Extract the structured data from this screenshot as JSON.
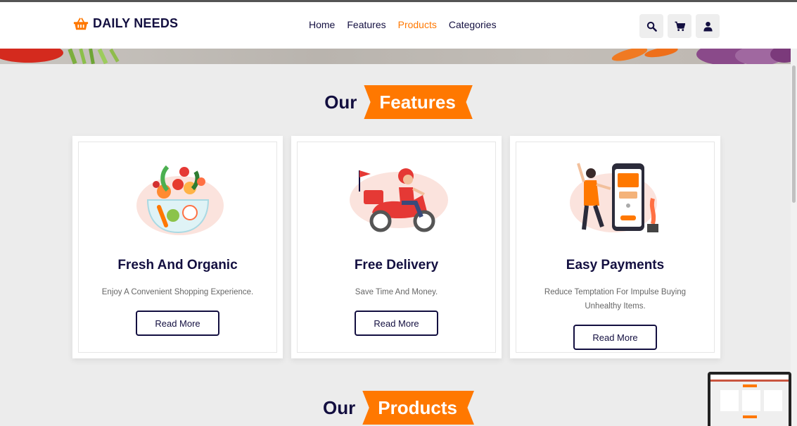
{
  "brand": {
    "name": "DAILY NEEDS",
    "accent": "#ff7800",
    "dark": "#130f40"
  },
  "nav": {
    "items": [
      {
        "label": "Home",
        "active": false
      },
      {
        "label": "Features",
        "active": false
      },
      {
        "label": "Products",
        "active": true
      },
      {
        "label": "Categories",
        "active": false
      }
    ]
  },
  "header_icons": [
    "search-icon",
    "cart-icon",
    "user-icon"
  ],
  "features_section": {
    "heading_plain": "Our",
    "heading_highlight": "Features"
  },
  "cards": [
    {
      "title": "Fresh And Organic",
      "description": "Enjoy A Convenient Shopping Experience.",
      "button": "Read More",
      "illustration": "vegetable-bowl-icon"
    },
    {
      "title": "Free Delivery",
      "description": "Save Time And Money.",
      "button": "Read More",
      "illustration": "delivery-scooter-icon"
    },
    {
      "title": "Easy Payments",
      "description": "Reduce Temptation For Impulse Buying Unhealthy Items.",
      "button": "Read More",
      "illustration": "phone-payment-icon"
    }
  ],
  "products_section": {
    "heading_plain": "Our",
    "heading_highlight": "Products"
  }
}
